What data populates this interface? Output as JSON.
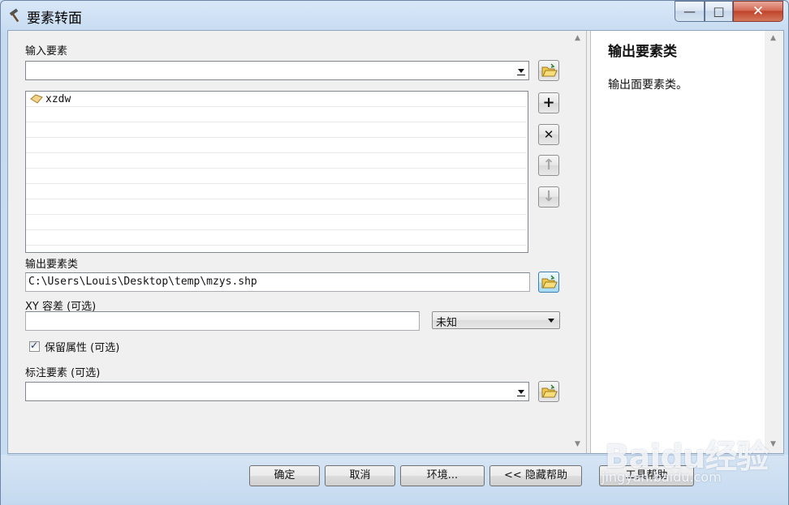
{
  "window": {
    "title": "要素转面",
    "controls": {
      "minimize": "—",
      "maximize": "□",
      "close": "✕"
    }
  },
  "form": {
    "input_features_label": "输入要素",
    "input_features_value": "",
    "input_list": [
      {
        "name": "xzdw",
        "icon": "polygon-layer-icon"
      },
      {
        "name": ""
      },
      {
        "name": ""
      },
      {
        "name": ""
      },
      {
        "name": ""
      },
      {
        "name": ""
      },
      {
        "name": ""
      },
      {
        "name": ""
      },
      {
        "name": ""
      },
      {
        "name": ""
      }
    ],
    "output_label": "输出要素类",
    "output_value": "C:\\Users\\Louis\\Desktop\\temp\\mzys.shp",
    "xy_tolerance_label": "XY 容差 (可选)",
    "xy_tolerance_value": "",
    "xy_unit_value": "未知",
    "preserve_attributes_label": "保留属性 (可选)",
    "preserve_attributes_checked": true,
    "label_features_label": "标注要素 (可选)",
    "label_features_value": ""
  },
  "help_panel": {
    "title": "输出要素类",
    "description": "输出面要素类。"
  },
  "buttons": {
    "ok": "确定",
    "cancel": "取消",
    "environments": "环境...",
    "hide_help": "<< 隐藏帮助",
    "tool_help": "工具帮助"
  },
  "watermark": {
    "logo": "Baidu经验",
    "url": "jingyan.baidu.com"
  },
  "colors": {
    "title_bar": "#c6dbf1",
    "dialog_background": "#f0f0f0",
    "close_button": "#c0442b",
    "active_button": "#bee6fd"
  }
}
